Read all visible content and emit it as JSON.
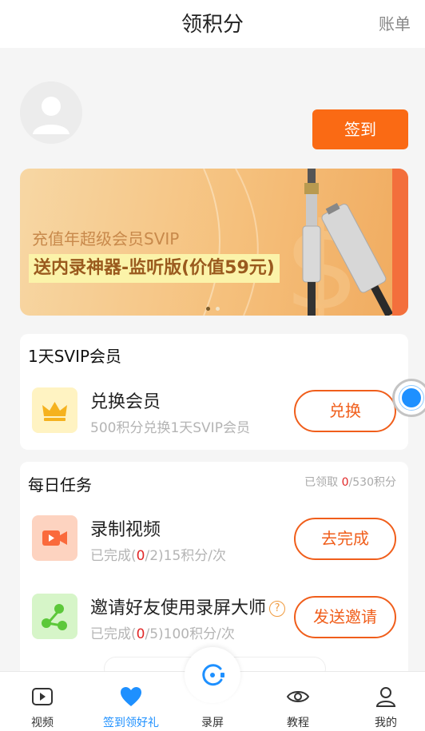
{
  "header": {
    "title": "领积分",
    "bill_label": "账单"
  },
  "profile": {
    "signin_label": "签到"
  },
  "banner": {
    "line1": "充值年超级会员SVIP",
    "line2": "送内录神器-监听版(价值59元)",
    "page_indicator": {
      "current": 1,
      "total": 2
    }
  },
  "vip_card": {
    "title": "1天SVIP会员",
    "item": {
      "name": "兑换会员",
      "desc": "500积分兑换1天SVIP会员",
      "button": "兑换",
      "icon": "crown-icon"
    }
  },
  "daily_tasks": {
    "title": "每日任务",
    "claimed_prefix": "已领取 ",
    "claimed_value": "0",
    "claimed_suffix": "/530积分",
    "tasks": [
      {
        "name": "录制视频",
        "sub_prefix": "已完成(",
        "sub_count": "0",
        "sub_suffix": "/2)15积分/次",
        "button": "去完成",
        "icon": "video-camera-icon",
        "icon_color": "#fa6a3c"
      },
      {
        "name": "邀请好友使用录屏大师",
        "help": "?",
        "sub_prefix": "已完成(",
        "sub_count": "0",
        "sub_suffix": "/5)100积分/次",
        "button": "发送邀请",
        "icon": "share-icon",
        "icon_color": "#5cc83a"
      }
    ]
  },
  "tabbar": {
    "items": [
      {
        "label": "视频",
        "icon": "video-play-icon"
      },
      {
        "label": "签到领好礼",
        "icon": "heart-icon",
        "active": true
      },
      {
        "label": "录屏",
        "icon": "record-icon"
      },
      {
        "label": "教程",
        "icon": "eye-icon"
      },
      {
        "label": "我的",
        "icon": "user-icon"
      }
    ]
  },
  "colors": {
    "accent_orange": "#fa6a14",
    "accent_blue": "#1e90ff",
    "highlight_red": "#e12828"
  }
}
